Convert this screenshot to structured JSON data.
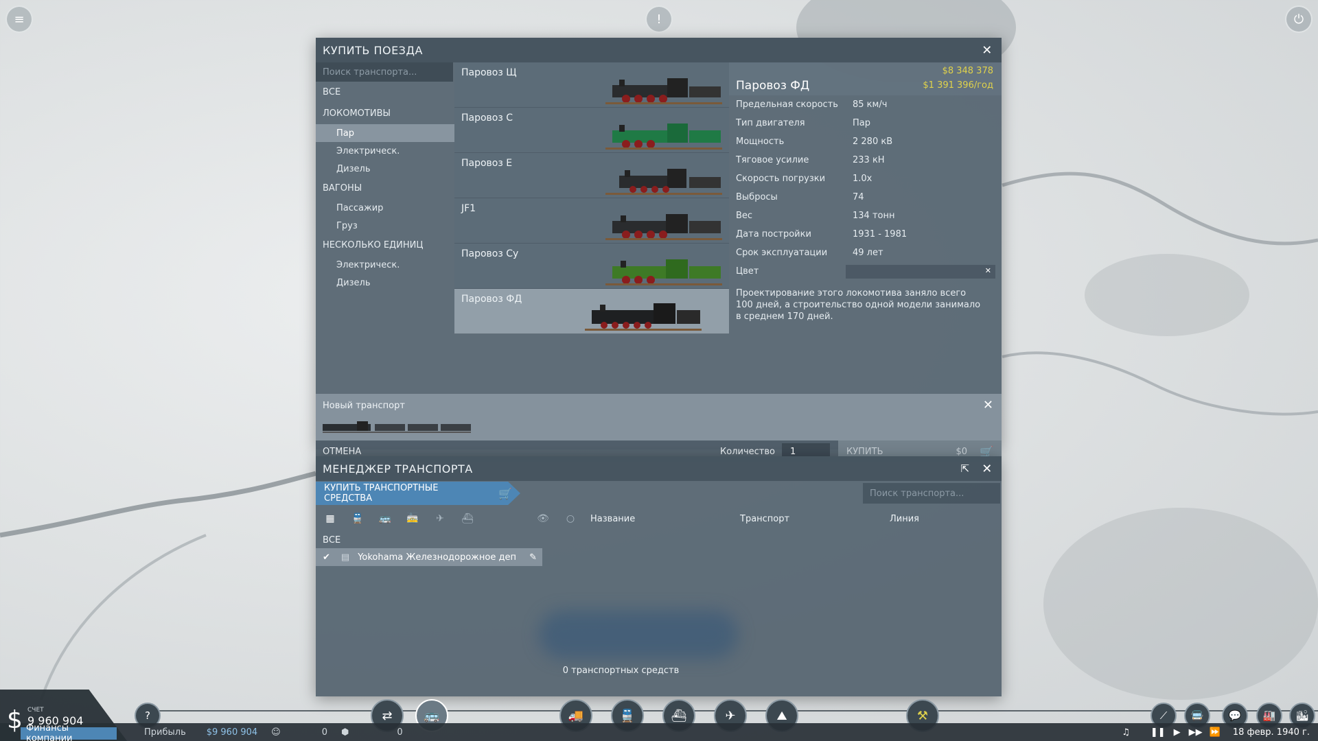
{
  "buy_trains": {
    "title": "КУПИТЬ ПОЕЗДА",
    "search_placeholder": "Поиск транспорта...",
    "categories": {
      "all": "ВСЕ",
      "locomotives": "ЛОКОМОТИВЫ",
      "loco_steam": "Пар",
      "loco_electric": "Электрическ.",
      "loco_diesel": "Дизель",
      "wagons": "ВАГОНЫ",
      "wagon_passenger": "Пассажир",
      "wagon_cargo": "Груз",
      "multiple_units": "НЕСКОЛЬКО ЕДИНИЦ",
      "mu_electric": "Электрическ.",
      "mu_diesel": "Дизель"
    },
    "models": [
      {
        "name": "Паровоз Щ"
      },
      {
        "name": "Паровоз С"
      },
      {
        "name": "Паровоз Е"
      },
      {
        "name": "JF1"
      },
      {
        "name": "Паровоз Су"
      },
      {
        "name": "Паровоз ФД"
      }
    ],
    "details": {
      "name": "Паровоз ФД",
      "price": "$8 348 378",
      "upkeep": "$1 391 396/год",
      "stats": [
        {
          "label": "Предельная скорость",
          "value": "85 км/ч"
        },
        {
          "label": "Тип двигателя",
          "value": "Пар"
        },
        {
          "label": "Мощность",
          "value": "2 280 кВ"
        },
        {
          "label": "Тяговое усилие",
          "value": "233 кН"
        },
        {
          "label": "Скорость погрузки",
          "value": "1.0x"
        },
        {
          "label": "Выбросы",
          "value": "74"
        },
        {
          "label": "Вес",
          "value": "134 тонн"
        },
        {
          "label": "Дата постройки",
          "value": "1931 - 1981"
        },
        {
          "label": "Срок эксплуатации",
          "value": "49 лет"
        }
      ],
      "color_label": "Цвет",
      "description": "Проектирование этого локомотива заняло всего 100 дней, а строительство одной модели занимало в среднем 170 дней."
    },
    "new_vehicle_label": "Новый транспорт",
    "cancel_label": "ОТМЕНА",
    "quantity_label": "Количество",
    "quantity_value": "1",
    "buy_label": "КУПИТЬ",
    "buy_price": "$0"
  },
  "transport_manager": {
    "title": "МЕНЕДЖЕР ТРАНСПОРТА",
    "buy_vehicles_label": "КУПИТЬ ТРАНСПОРТНЫЕ СРЕДСТВА",
    "search_placeholder": "Поиск транспорта...",
    "columns": {
      "name": "Название",
      "vehicle": "Транспорт",
      "line": "Линия"
    },
    "all_label": "ВСЕ",
    "depot_item": "Yokohama Железнодорожное деп",
    "count_text": "0 транспортных средств"
  },
  "status_bar": {
    "account_label": "СЧЕТ",
    "account_value": "9 960 904",
    "finances_label": "Финансы компании",
    "profit_label": "Прибыль",
    "profit_value": "$9 960 904",
    "count_a": "0",
    "count_b": "0",
    "date": "18 февр. 1940 г."
  },
  "colors": {
    "accent_blue": "#4d86b5",
    "price_yellow": "#e0d24b",
    "panel_bg": "#566571"
  }
}
